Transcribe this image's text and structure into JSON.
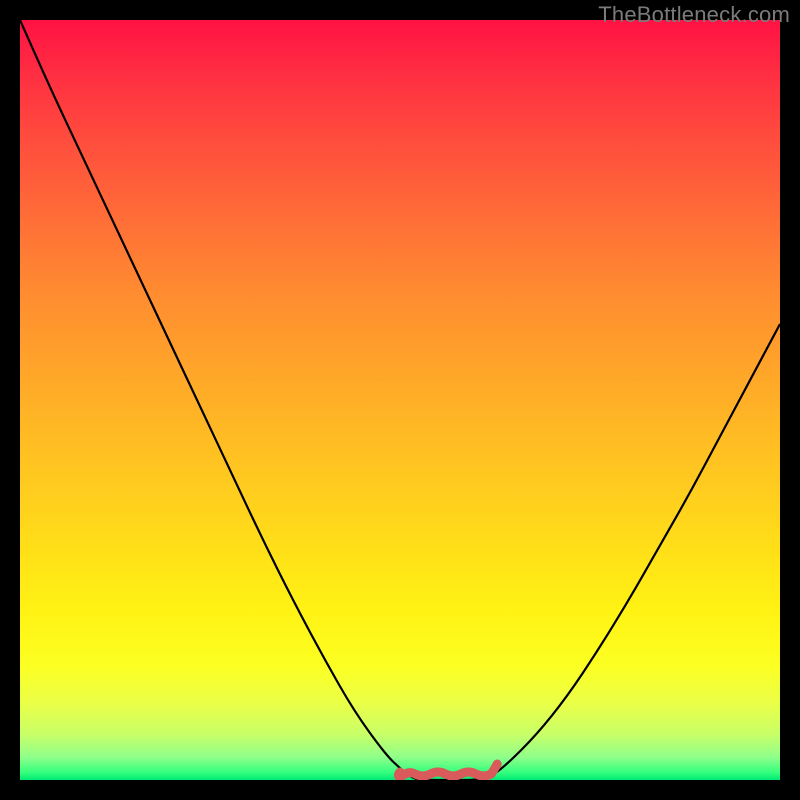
{
  "watermark": "TheBottleneck.com",
  "colors": {
    "background": "#000000",
    "curve": "#000000",
    "squiggle": "#d85a5a",
    "watermark": "#7b7b7b"
  },
  "chart_data": {
    "type": "line",
    "title": "",
    "xlabel": "",
    "ylabel": "",
    "xlim": [
      0,
      100
    ],
    "ylim": [
      0,
      100
    ],
    "grid": false,
    "series": [
      {
        "name": "bottleneck-curve",
        "x": [
          0,
          4,
          8,
          12,
          16,
          20,
          24,
          28,
          32,
          36,
          40,
          44,
          48,
          50,
          52,
          54,
          56,
          58,
          60,
          62,
          64,
          68,
          72,
          76,
          80,
          84,
          88,
          92,
          96,
          100
        ],
        "values": [
          100,
          91,
          82.5,
          74,
          65.5,
          57,
          48.5,
          40,
          31.5,
          23.5,
          16,
          9,
          3.5,
          1.5,
          0,
          0,
          0,
          0,
          0,
          0.5,
          2,
          6,
          11,
          17,
          23.5,
          30.5,
          37.5,
          45,
          52.5,
          60
        ]
      }
    ],
    "annotation": {
      "name": "bottom-squiggle",
      "x_range": [
        50,
        62
      ],
      "y": 0,
      "color": "#d85a5a"
    },
    "legend": false
  }
}
